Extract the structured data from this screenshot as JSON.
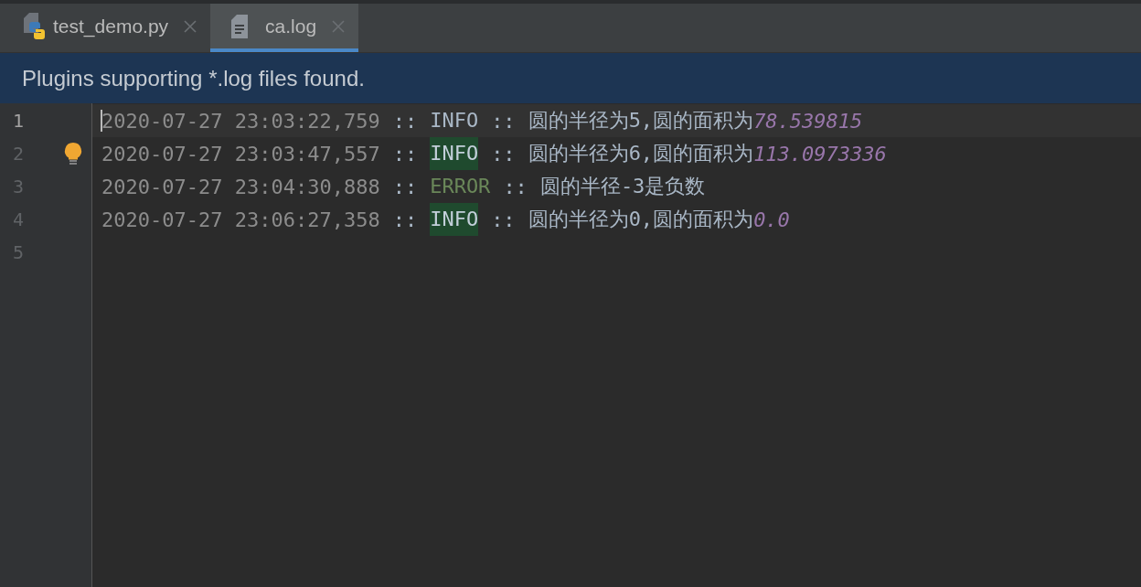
{
  "tabs": [
    {
      "label": "test_demo.py",
      "kind": "python",
      "selected": false
    },
    {
      "label": "ca.log",
      "kind": "text",
      "selected": true
    }
  ],
  "banner": {
    "text": "Plugins supporting *.log files found."
  },
  "editor": {
    "lines": [
      {
        "number": "1",
        "current": true,
        "timestamp": "2020-07-27 23:03:22,759",
        "sep1": "::",
        "level": "INFO",
        "kind": "info",
        "highlighted": false,
        "sep2": "::",
        "message": "圆的半径为5,圆的面积为",
        "value": "78.539815"
      },
      {
        "number": "2",
        "current": false,
        "timestamp": "2020-07-27 23:03:47,557",
        "sep1": "::",
        "level": "INFO",
        "kind": "info",
        "highlighted": true,
        "sep2": "::",
        "message": "圆的半径为6,圆的面积为",
        "value": "113.0973336"
      },
      {
        "number": "3",
        "current": false,
        "timestamp": "2020-07-27 23:04:30,888",
        "sep1": "::",
        "level": "ERROR",
        "kind": "error",
        "highlighted": false,
        "sep2": "::",
        "message": "圆的半径-3是负数"
      },
      {
        "number": "4",
        "current": false,
        "timestamp": "2020-07-27 23:06:27,358",
        "sep1": "::",
        "level": "INFO",
        "kind": "info",
        "highlighted": true,
        "sep2": "::",
        "message": "圆的半径为0,圆的面积为",
        "value": "0.0"
      },
      {
        "number": "5",
        "current": false
      }
    ]
  }
}
